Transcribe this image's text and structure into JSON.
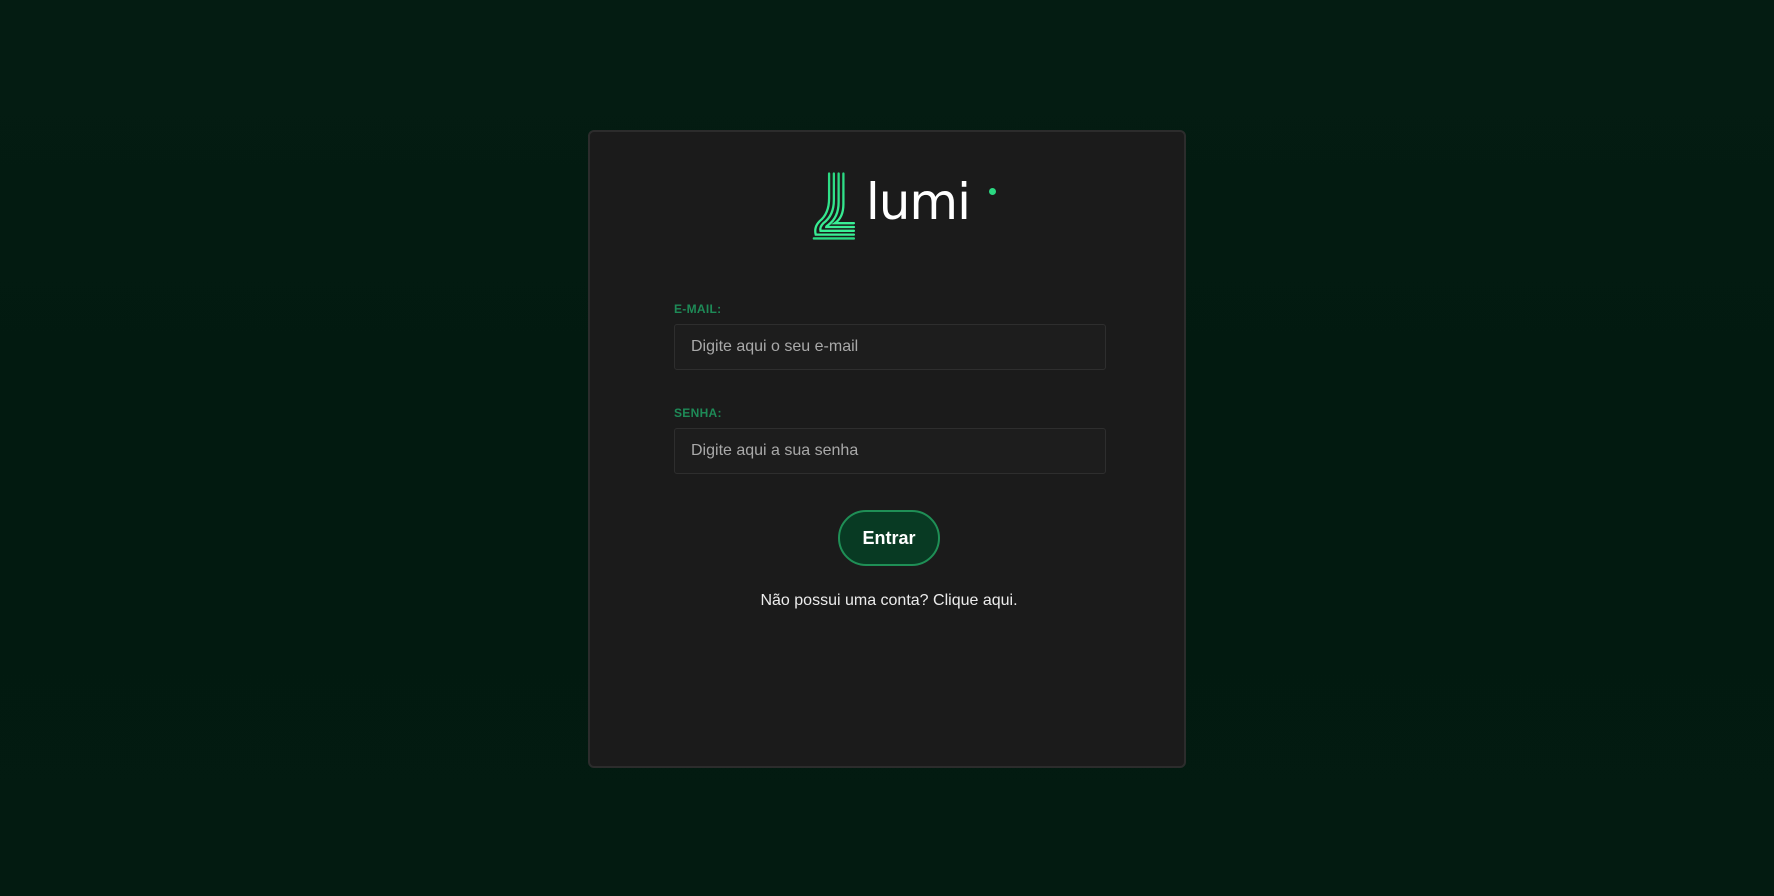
{
  "brand": {
    "name": "lumi",
    "logo_icon": "lumi-stripes-logo-icon",
    "accent_color": "#2bd982"
  },
  "form": {
    "email": {
      "label": "E-MAIL:",
      "placeholder": "Digite aqui o seu e-mail",
      "value": ""
    },
    "password": {
      "label": "SENHA:",
      "placeholder": "Digite aqui a sua senha",
      "value": ""
    },
    "submit_label": "Entrar"
  },
  "signup": {
    "prompt": "Não possui uma conta?",
    "link_text": "Clique aqui."
  },
  "colors": {
    "background": "#021a10",
    "card": "#1b1b1b",
    "label": "#1e8a57",
    "button_fill": "#083a23",
    "button_border": "#1f8f56"
  }
}
